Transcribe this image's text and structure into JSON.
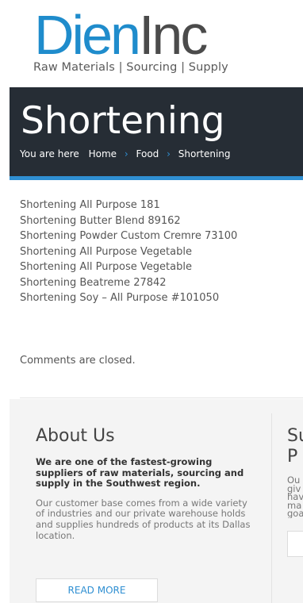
{
  "header": {
    "logo_word_main": "Dien",
    "logo_word_inc": "Inc",
    "logo_tagline": "Raw Materials | Sourcing | Supply"
  },
  "title_band": {
    "title": "Shortening",
    "breadcrumb": {
      "prefix": "You are here",
      "items": [
        "Home",
        "Food",
        "Shortening"
      ],
      "separator": "›"
    }
  },
  "content": {
    "products": [
      "Shortening All Purpose 181",
      "Shortening Butter Blend 89162",
      "Shortening Powder Custom Cremre 73100",
      "Shortening All Purpose Vegetable",
      "Shortening All Purpose Vegetable",
      "Shortening Beatreme 27842",
      "Shortening Soy – All Purpose #101050"
    ],
    "comments_status": "Comments are closed."
  },
  "footer": {
    "about": {
      "title": "About Us",
      "lead": "We are one of the fastest-growing suppliers of raw materials, sourcing and supply in the Southwest region.",
      "body": "Our customer base comes from a wide variety of industries and our private warehouse holds and supplies hundreds of products at its Dallas location.",
      "button_label": "READ MORE"
    },
    "second_widget": {
      "title_partial": "Su\nP",
      "body_partial": "Ou\ngiv\nhav\nma\ngoa"
    }
  },
  "colors": {
    "brand_blue": "#1f8ccc",
    "title_band_bg": "#262d35",
    "accent_blue": "#2f8fd2",
    "footer_bg": "#f4f4f4"
  }
}
